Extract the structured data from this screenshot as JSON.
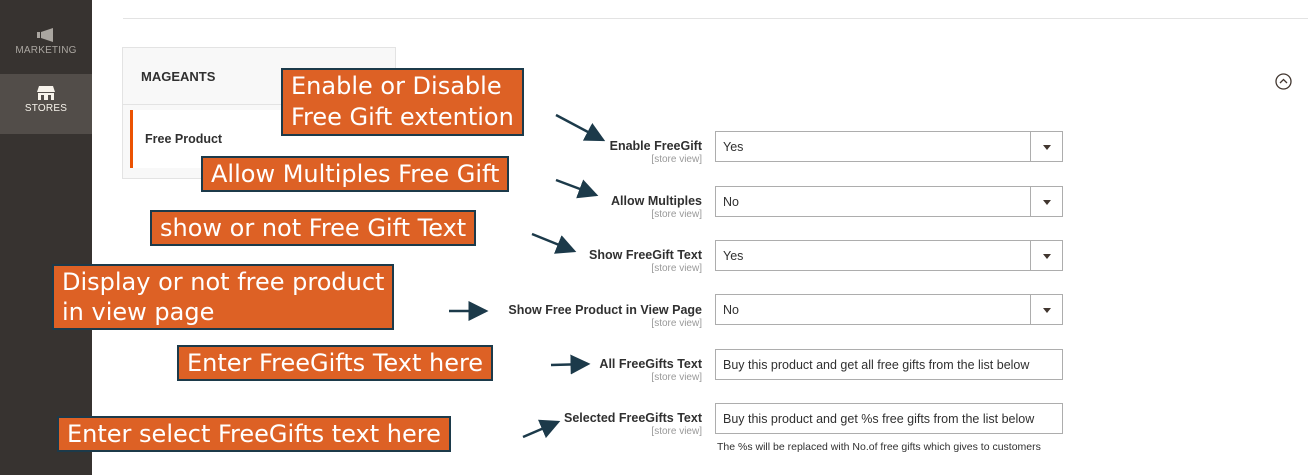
{
  "sidebar": {
    "items": [
      {
        "label": "MARKETING",
        "icon": "megaphone-icon"
      },
      {
        "label": "STORES",
        "icon": "store-icon"
      }
    ]
  },
  "config_tabs": {
    "section_title": "MAGEANTS",
    "active_item": "Free Product"
  },
  "form": {
    "rows": [
      {
        "label": "Enable FreeGift",
        "scope": "[store view]",
        "value": "Yes"
      },
      {
        "label": "Allow Multiples",
        "scope": "[store view]",
        "value": "No"
      },
      {
        "label": "Show FreeGift Text",
        "scope": "[store view]",
        "value": "Yes"
      },
      {
        "label": "Show Free Product in View Page",
        "scope": "[store view]",
        "value": "No"
      },
      {
        "label": "All FreeGifts Text",
        "scope": "[store view]",
        "value": "Buy this product and get all free gifts from the list below"
      },
      {
        "label": "Selected FreeGifts Text",
        "scope": "[store view]",
        "value": "Buy this product and get %s free gifts from the list below"
      }
    ],
    "selected_note": "The %s will be replaced with No.of free gifts which gives to customers"
  },
  "annotations": {
    "enable": [
      "Enable or Disable",
      "Free Gift extention"
    ],
    "multiples": "Allow Multiples Free Gift",
    "show_text": "show or not Free Gift Text",
    "view_page": [
      "Display or not free product",
      "in view page"
    ],
    "all_text": "Enter FreeGifts Text here",
    "select_text": "Enter select FreeGifts text here"
  },
  "colors": {
    "sidebar_bg": "#373330",
    "active_tab_accent": "#eb5202",
    "callout_bg": "#dd6125",
    "callout_border": "#1c3a4a"
  }
}
